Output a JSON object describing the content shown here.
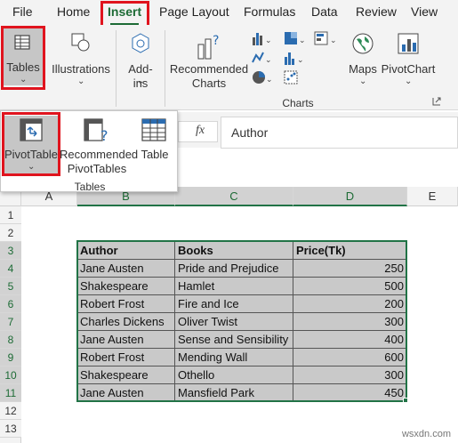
{
  "menu": {
    "tabs": [
      "File",
      "Home",
      "Insert",
      "Page Layout",
      "Formulas",
      "Data",
      "Review",
      "View"
    ]
  },
  "ribbon": {
    "tables_label": "Tables",
    "illustrations_label": "Illustrations",
    "addins_label": "Add-ins",
    "recommended_charts_line1": "Recommended",
    "recommended_charts_line2": "Charts",
    "maps_label": "Maps",
    "pivotchart_label": "PivotChart",
    "charts_group_label": "Charts"
  },
  "tables_dropdown": {
    "pivottable_label": "PivotTable",
    "recommended_line1": "Recommended",
    "recommended_line2": "PivotTables",
    "table_label": "Table",
    "group_label": "Tables"
  },
  "formula_bar": {
    "fx": "fx",
    "value": "Author"
  },
  "grid": {
    "columns": [
      "A",
      "B",
      "C",
      "D",
      "E"
    ],
    "rows": [
      "1",
      "2",
      "3",
      "4",
      "5",
      "6",
      "7",
      "8",
      "9",
      "10",
      "11",
      "12",
      "13"
    ],
    "table_headers": [
      "Author",
      "Books",
      "Price(Tk)"
    ],
    "table_rows": [
      [
        "Jane Austen",
        "Pride and Prejudice",
        "250"
      ],
      [
        "Shakespeare",
        "Hamlet",
        "500"
      ],
      [
        "Robert Frost",
        "Fire and Ice",
        "200"
      ],
      [
        "Charles Dickens",
        "Oliver Twist",
        "300"
      ],
      [
        "Jane Austen",
        "Sense and Sensibility",
        "400"
      ],
      [
        "Robert Frost",
        "Mending Wall",
        "600"
      ],
      [
        "Shakespeare",
        "Othello",
        "300"
      ],
      [
        "Jane Austen",
        "Mansfield Park",
        "450"
      ]
    ]
  },
  "watermark": "wsxdn.com",
  "colors": {
    "accent": "#1d6b35",
    "highlight": "#e0141e",
    "cell_fill": "#c9c9c9"
  }
}
